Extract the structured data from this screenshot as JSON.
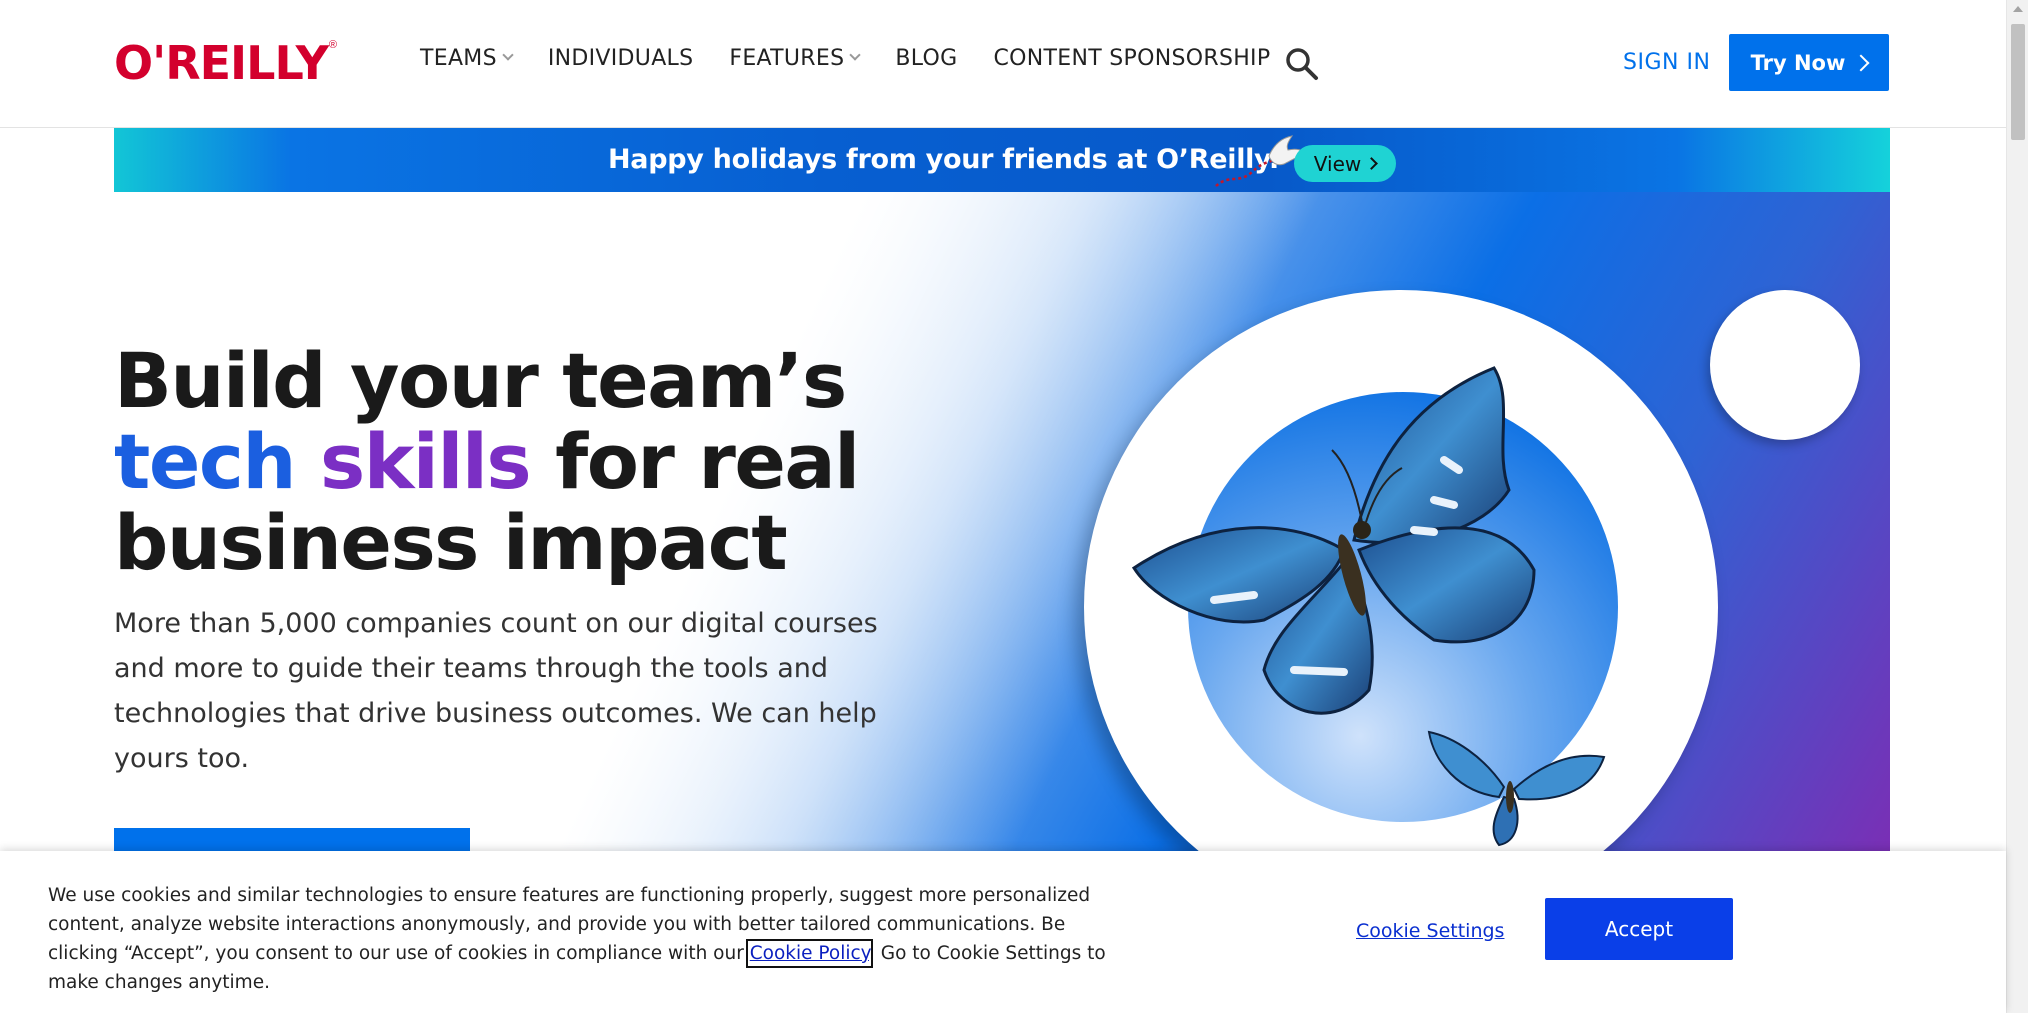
{
  "header": {
    "logo_text": "O'REILLY",
    "logo_reg": "®",
    "nav": {
      "teams": "TEAMS",
      "individuals": "INDIVIDUALS",
      "features": "FEATURES",
      "blog": "BLOG",
      "content_sponsorship": "CONTENT SPONSORSHIP"
    },
    "sign_in": "SIGN IN",
    "try_now": "Try Now"
  },
  "banner": {
    "text": "Happy holidays from your friends at O’Reilly.",
    "button": "View"
  },
  "hero": {
    "headline_line1": "Build your team’s",
    "headline_blue": "tech ",
    "headline_purple": "skills",
    "headline_rest": " for real",
    "headline_line3": "business impact",
    "subtext": "More than 5,000 companies count on our digital courses and more to guide their teams through the tools and technologies that drive business outcomes. We can help yours too."
  },
  "cookie_banner": {
    "text_before": "We use cookies and similar technologies to ensure features are functioning properly, suggest more personalized content, analyze website interactions anonymously, and provide you with better tailored communications. Be clicking “Accept”, you consent to our use of cookies in compliance with our ",
    "link": "Cookie Policy",
    "text_after": ". Go to Cookie Settings to make changes anytime.",
    "settings": "Cookie Settings",
    "accept": "Accept"
  },
  "colors": {
    "brand_red": "#d3002d",
    "primary_blue": "#0071eb",
    "accent_purple": "#7b2fc4"
  },
  "icons": [
    "search-icon",
    "chevron-down-icon",
    "chevron-right-icon"
  ]
}
